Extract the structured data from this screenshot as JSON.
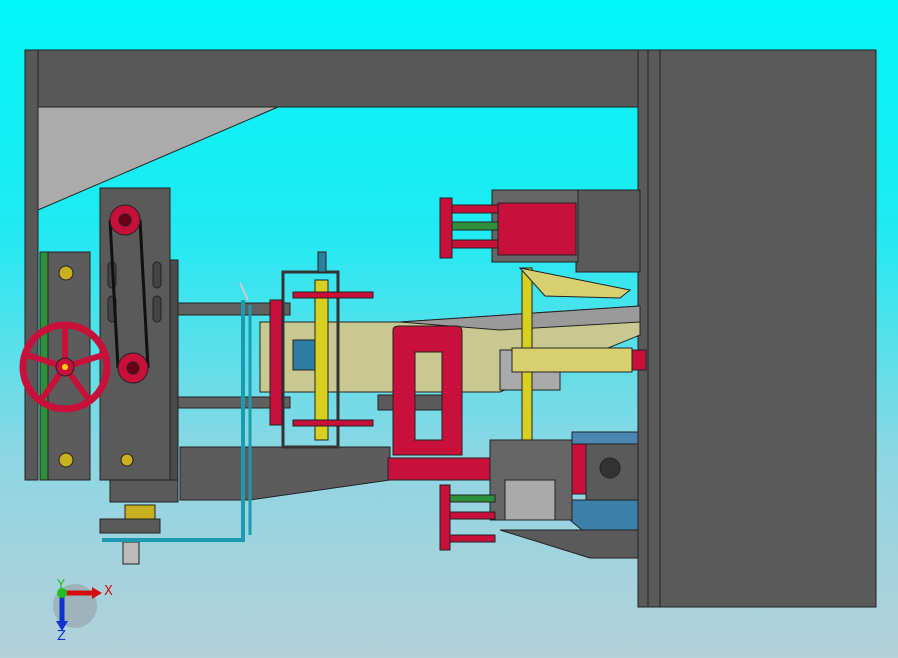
{
  "viewport": {
    "triad": {
      "x_label": "X",
      "y_label": "Y",
      "z_label": "Z"
    }
  },
  "colors": {
    "frame": "#555555",
    "frame_edge": "#2a2a2a",
    "red_part": "#c8103a",
    "yellow_shaft": "#d8d020",
    "olive_box": "#c8c890",
    "teal_pipe": "#1b9ab0",
    "green_rail": "#2f8f3a"
  }
}
